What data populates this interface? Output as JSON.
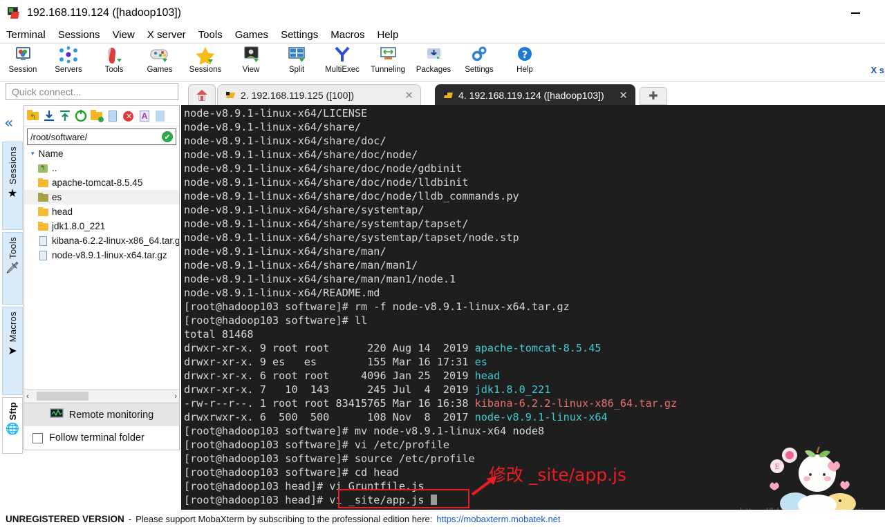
{
  "window": {
    "title": "192.168.119.124 ([hadoop103])",
    "app_icon": "mobaxterm-icon",
    "minimize_label": "–"
  },
  "menubar": {
    "items": [
      {
        "label": "Terminal"
      },
      {
        "label": "Sessions"
      },
      {
        "label": "View"
      },
      {
        "label": "X server"
      },
      {
        "label": "Tools"
      },
      {
        "label": "Games"
      },
      {
        "label": "Settings"
      },
      {
        "label": "Macros"
      },
      {
        "label": "Help"
      }
    ]
  },
  "toolbar": {
    "buttons": [
      {
        "label": "Session",
        "icon": "session-icon"
      },
      {
        "label": "Servers",
        "icon": "servers-icon"
      },
      {
        "label": "Tools",
        "icon": "tools-icon"
      },
      {
        "label": "Games",
        "icon": "games-icon"
      },
      {
        "label": "Sessions",
        "icon": "sessions-star-icon"
      },
      {
        "label": "View",
        "icon": "view-icon"
      },
      {
        "label": "Split",
        "icon": "split-icon"
      },
      {
        "label": "MultiExec",
        "icon": "multiexec-icon"
      },
      {
        "label": "Tunneling",
        "icon": "tunneling-icon"
      },
      {
        "label": "Packages",
        "icon": "packages-icon"
      },
      {
        "label": "Settings",
        "icon": "settings-gear-icon"
      },
      {
        "label": "Help",
        "icon": "help-icon"
      }
    ],
    "clipped_right_label": "X s"
  },
  "quick_connect": {
    "placeholder": "Quick connect...",
    "value": ""
  },
  "sidebar_tabs": {
    "collapse_glyph": "«",
    "items": [
      {
        "label": "Sessions",
        "icon": "star-icon",
        "selected": false
      },
      {
        "label": "Tools",
        "icon": "swiss-knife-icon",
        "selected": false
      },
      {
        "label": "Macros",
        "icon": "paper-plane-icon",
        "selected": false
      },
      {
        "label": "Sftp",
        "icon": "globe-icon",
        "selected": true
      }
    ]
  },
  "file_panel": {
    "toolbar_icons": [
      "go-up-icon",
      "download-icon",
      "upload-icon",
      "refresh-icon",
      "new-folder-icon",
      "new-file-icon",
      "delete-icon",
      "text-mode-icon"
    ],
    "path": "/root/software/",
    "path_ok_glyph": "✔",
    "column_header": "Name",
    "sort_caret": "▾",
    "rows": [
      {
        "name": "..",
        "type": "parent"
      },
      {
        "name": "apache-tomcat-8.5.45",
        "type": "folder"
      },
      {
        "name": "es",
        "type": "folder-olive",
        "highlighted": true
      },
      {
        "name": "head",
        "type": "folder"
      },
      {
        "name": "jdk1.8.0_221",
        "type": "folder"
      },
      {
        "name": "kibana-6.2.2-linux-x86_64.tar.gz",
        "type": "file"
      },
      {
        "name": "node-v8.9.1-linux-x64.tar.gz",
        "type": "file"
      }
    ],
    "hscroll_left_glyph": "‹",
    "hscroll_right_glyph": "›",
    "remote_monitoring_label": "Remote monitoring",
    "remote_monitoring_icon": "monitor-graph-icon",
    "follow_terminal_label": "Follow terminal folder",
    "follow_terminal_checked": false
  },
  "tabs": {
    "home_icon": "home-icon",
    "add_glyph": "✚",
    "close_glyph": "✕",
    "items": [
      {
        "label": "2. 192.168.119.125 ([100])",
        "active": false,
        "icon": "plug-icon"
      },
      {
        "label": "4. 192.168.119.124 ([hadoop103])",
        "active": true,
        "icon": "plug-icon"
      }
    ]
  },
  "terminal": {
    "lines": [
      [
        {
          "t": "node-v8.9.1-linux-x64/LICENSE",
          "c": "white"
        }
      ],
      [
        {
          "t": "node-v8.9.1-linux-x64/share/",
          "c": "white"
        }
      ],
      [
        {
          "t": "node-v8.9.1-linux-x64/share/doc/",
          "c": "white"
        }
      ],
      [
        {
          "t": "node-v8.9.1-linux-x64/share/doc/node/",
          "c": "white"
        }
      ],
      [
        {
          "t": "node-v8.9.1-linux-x64/share/doc/node/gdbinit",
          "c": "white"
        }
      ],
      [
        {
          "t": "node-v8.9.1-linux-x64/share/doc/node/lldbinit",
          "c": "white"
        }
      ],
      [
        {
          "t": "node-v8.9.1-linux-x64/share/doc/node/lldb_commands.py",
          "c": "white"
        }
      ],
      [
        {
          "t": "node-v8.9.1-linux-x64/share/systemtap/",
          "c": "white"
        }
      ],
      [
        {
          "t": "node-v8.9.1-linux-x64/share/systemtap/tapset/",
          "c": "white"
        }
      ],
      [
        {
          "t": "node-v8.9.1-linux-x64/share/systemtap/tapset/node.stp",
          "c": "white"
        }
      ],
      [
        {
          "t": "node-v8.9.1-linux-x64/share/man/",
          "c": "white"
        }
      ],
      [
        {
          "t": "node-v8.9.1-linux-x64/share/man/man1/",
          "c": "white"
        }
      ],
      [
        {
          "t": "node-v8.9.1-linux-x64/share/man/man1/node.1",
          "c": "white"
        }
      ],
      [
        {
          "t": "node-v8.9.1-linux-x64/README.md",
          "c": "white"
        }
      ],
      [
        {
          "t": "[root@hadoop103 software]# rm -f node-v8.9.1-linux-x64.tar.gz",
          "c": "white"
        }
      ],
      [
        {
          "t": "[root@hadoop103 software]# ll",
          "c": "white"
        }
      ],
      [
        {
          "t": "total 81468",
          "c": "white"
        }
      ],
      [
        {
          "t": "drwxr-xr-x. 9 root root      220 Aug 14  2019 ",
          "c": "white"
        },
        {
          "t": "apache-tomcat-8.5.45",
          "c": "cyan"
        }
      ],
      [
        {
          "t": "drwxr-xr-x. 9 es   es        155 Mar 16 17:31 ",
          "c": "white"
        },
        {
          "t": "es",
          "c": "cyan"
        }
      ],
      [
        {
          "t": "drwxr-xr-x. 6 root root     4096 Jan 25  2019 ",
          "c": "white"
        },
        {
          "t": "head",
          "c": "cyan"
        }
      ],
      [
        {
          "t": "drwxr-xr-x. 7   10  143      245 Jul  4  2019 ",
          "c": "white"
        },
        {
          "t": "jdk1.8.0_221",
          "c": "cyan"
        }
      ],
      [
        {
          "t": "-rw-r--r--. 1 root root 83415765 Mar 16 16:38 ",
          "c": "white"
        },
        {
          "t": "kibana-6.2.2-linux-x86_64.tar.gz",
          "c": "red"
        }
      ],
      [
        {
          "t": "drwxrwxr-x. 6  500  500      108 Nov  8  2017 ",
          "c": "white"
        },
        {
          "t": "node-v8.9.1-linux-x64",
          "c": "cyan"
        }
      ],
      [
        {
          "t": "[root@hadoop103 software]# mv node-v8.9.1-linux-x64 node8",
          "c": "white"
        }
      ],
      [
        {
          "t": "[root@hadoop103 software]# vi /etc/profile",
          "c": "white"
        }
      ],
      [
        {
          "t": "[root@hadoop103 software]# source /etc/profile",
          "c": "white"
        }
      ],
      [
        {
          "t": "[root@hadoop103 software]# cd head",
          "c": "white"
        }
      ],
      [
        {
          "t": "[root@hadoop103 head]# vi Gruntfile.js",
          "c": "white"
        }
      ],
      [
        {
          "t": "[root@hadoop103 head]# vi _site/app.js ",
          "c": "white",
          "cursor": true
        }
      ]
    ]
  },
  "annotation": {
    "text": "修改 _site/app.js",
    "color": "#ec1c24",
    "box_target": "vi _site/app.js"
  },
  "watermark": {
    "text": "https://blog.csdn.net/jokertiger"
  },
  "statusbar": {
    "unregistered": "UNREGISTERED VERSION",
    "dash": "-",
    "message": "Please support MobaXterm by subscribing to the professional edition here:",
    "link": "https://mobaxterm.mobatek.net"
  },
  "colors": {
    "terminal_bg": "#1e1e1e",
    "terminal_fg": "#d6d6d6",
    "dir_cyan": "#3fc9d6",
    "archive_red": "#e8726b",
    "accent_blue": "#1f6fc4",
    "annotation_red": "#ec1c24",
    "link_blue": "#1559c8"
  }
}
